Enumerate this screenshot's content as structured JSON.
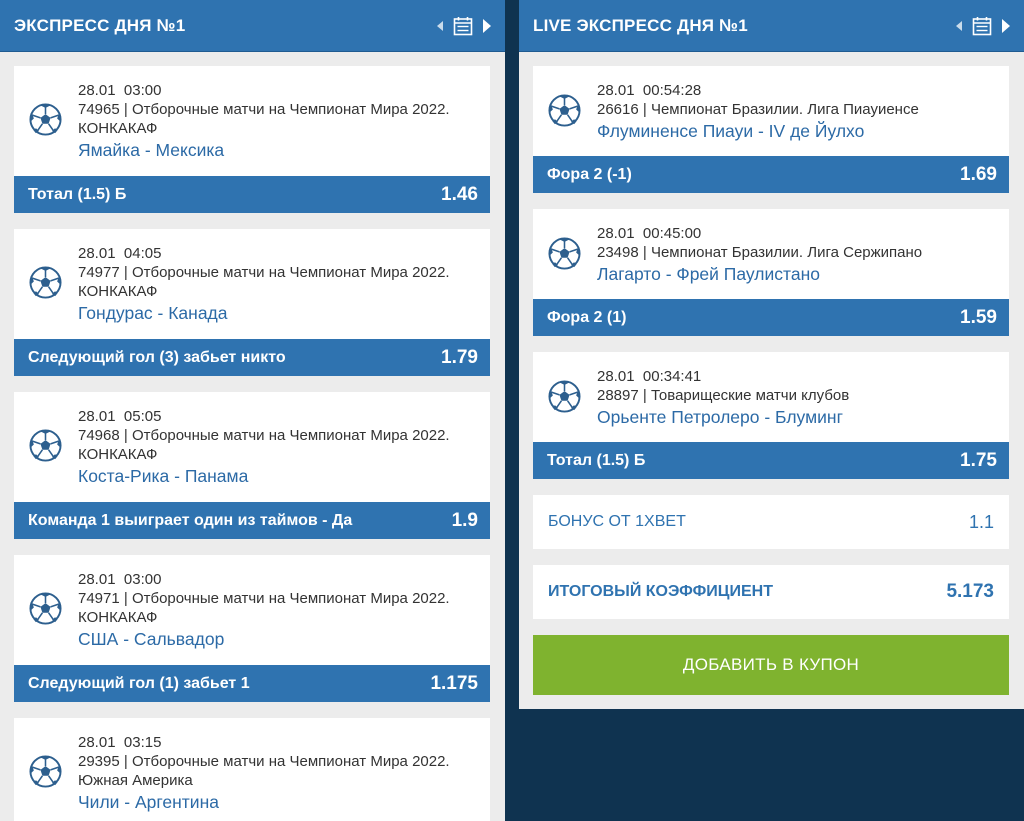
{
  "left": {
    "title": "ЭКСПРЕСС ДНЯ №1",
    "icons": {
      "prev": "chevron-left-icon",
      "calendar": "calendar-icon",
      "next": "chevron-right-icon"
    },
    "cards": [
      {
        "date": "28.01",
        "time": "03:00",
        "league": "74965 | Отборочные матчи на Чемпионат Мира 2022. КОНКАКАФ",
        "teams": "Ямайка - Мексика",
        "bet": "Тотал (1.5) Б",
        "odd": "1.46"
      },
      {
        "date": "28.01",
        "time": "04:05",
        "league": "74977 | Отборочные матчи на Чемпионат Мира 2022. КОНКАКАФ",
        "teams": "Гондурас - Канада",
        "bet": "Следующий гол (3) забьет никто",
        "odd": "1.79"
      },
      {
        "date": "28.01",
        "time": "05:05",
        "league": "74968 | Отборочные матчи на Чемпионат Мира 2022. КОНКАКАФ",
        "teams": "Коста-Рика - Панама",
        "bet": "Команда 1 выиграет один из таймов - Да",
        "odd": "1.9"
      },
      {
        "date": "28.01",
        "time": "03:00",
        "league": "74971 | Отборочные матчи на Чемпионат Мира 2022. КОНКАКАФ",
        "teams": "США - Сальвадор",
        "bet": "Следующий гол (1) забьет 1",
        "odd": "1.175"
      },
      {
        "date": "28.01",
        "time": "03:15",
        "league": "29395 | Отборочные матчи на Чемпионат Мира 2022. Южная Америка",
        "teams": "Чили - Аргентина",
        "bet": "",
        "odd": ""
      }
    ]
  },
  "right": {
    "title": "LIVE ЭКСПРЕСС ДНЯ №1",
    "icons": {
      "prev": "chevron-left-icon",
      "calendar": "calendar-icon",
      "next": "chevron-right-icon"
    },
    "cards": [
      {
        "date": "28.01",
        "time": "00:54:28",
        "league": "26616 | Чемпионат Бразилии. Лига Пиауиенсе",
        "teams": "Флуминенсе Пиауи - IV де Йулхо",
        "bet": "Фора 2 (-1)",
        "odd": "1.69"
      },
      {
        "date": "28.01",
        "time": "00:45:00",
        "league": "23498 | Чемпионат Бразилии. Лига Сержипано",
        "teams": "Лагарто - Фрей Паулистано",
        "bet": "Фора 2 (1)",
        "odd": "1.59"
      },
      {
        "date": "28.01",
        "time": "00:34:41",
        "league": "28897 | Товарищеские матчи клубов",
        "teams": "Орьенте Петролеро - Блуминг",
        "bet": "Тотал (1.5) Б",
        "odd": "1.75"
      }
    ],
    "bonus_label": "БОНУС ОТ 1XBET",
    "bonus_value": "1.1",
    "total_label": "ИТОГОВЫЙ КОЭФФИЦИЕНТ",
    "total_value": "5.173",
    "add_button": "ДОБАВИТЬ В КУПОН"
  },
  "colors": {
    "header": "#2f73b0",
    "bet_bar": "#2f73b0",
    "team_link": "#2c6aa6",
    "add_button": "#7fb32f",
    "panel_bg": "#ececec",
    "page_bg": "#0f3350"
  }
}
